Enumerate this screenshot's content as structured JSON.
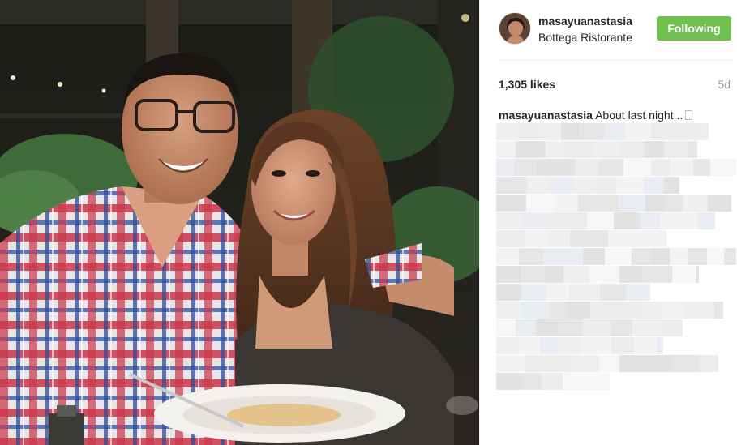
{
  "post": {
    "username": "masayuanastasia",
    "location": "Bottega Ristorante",
    "follow_label": "Following",
    "likes": "1,305 likes",
    "time_ago": "5d",
    "caption_user": "masayuanastasia",
    "caption_text": "About last night..."
  },
  "colors": {
    "follow_button": "#70c050",
    "text": "#262626",
    "muted": "#999999"
  },
  "icons": {
    "caption_emoji": "emoji-placeholder-icon"
  }
}
